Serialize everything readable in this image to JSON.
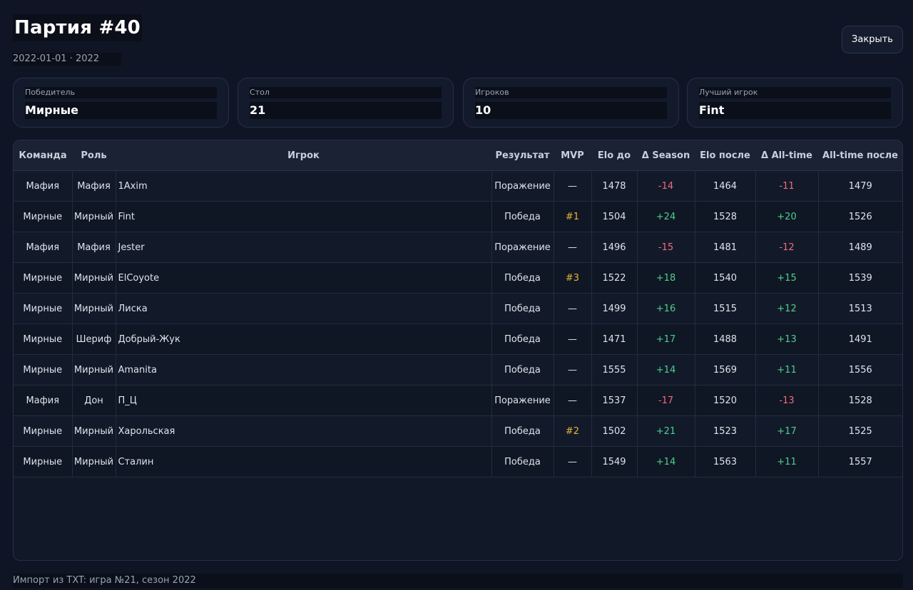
{
  "header": {
    "title": "Партия #40",
    "subtitle": "2022-01-01 · 2022",
    "close_label": "Закрыть"
  },
  "cards": [
    {
      "label": "Победитель",
      "value": "Мирные"
    },
    {
      "label": "Стол",
      "value": "21"
    },
    {
      "label": "Игроков",
      "value": "10"
    },
    {
      "label": "Лучший игрок",
      "value": "Fint"
    }
  ],
  "table": {
    "columns": [
      "Команда",
      "Роль",
      "Игрок",
      "Результат",
      "MVP",
      "Elo до",
      "Δ Season",
      "Elo после",
      "Δ All-time",
      "All-time после"
    ],
    "rows": [
      {
        "team": "Мафия",
        "role": "Мафия",
        "player": "1Axim",
        "result": "Поражение",
        "mvp": "—",
        "elo_before": "1478",
        "d_season": "-14",
        "elo_after": "1464",
        "d_alltime": "-11",
        "alltime_after": "1479"
      },
      {
        "team": "Мирные",
        "role": "Мирный",
        "player": "Fint",
        "result": "Победа",
        "mvp": "#1",
        "elo_before": "1504",
        "d_season": "+24",
        "elo_after": "1528",
        "d_alltime": "+20",
        "alltime_after": "1526"
      },
      {
        "team": "Мафия",
        "role": "Мафия",
        "player": "Jester",
        "result": "Поражение",
        "mvp": "—",
        "elo_before": "1496",
        "d_season": "-15",
        "elo_after": "1481",
        "d_alltime": "-12",
        "alltime_after": "1489"
      },
      {
        "team": "Мирные",
        "role": "Мирный",
        "player": "ElCoyote",
        "result": "Победа",
        "mvp": "#3",
        "elo_before": "1522",
        "d_season": "+18",
        "elo_after": "1540",
        "d_alltime": "+15",
        "alltime_after": "1539"
      },
      {
        "team": "Мирные",
        "role": "Мирный",
        "player": "Лиска",
        "result": "Победа",
        "mvp": "—",
        "elo_before": "1499",
        "d_season": "+16",
        "elo_after": "1515",
        "d_alltime": "+12",
        "alltime_after": "1513"
      },
      {
        "team": "Мирные",
        "role": "Шериф",
        "player": "Добрый-Жук",
        "result": "Победа",
        "mvp": "—",
        "elo_before": "1471",
        "d_season": "+17",
        "elo_after": "1488",
        "d_alltime": "+13",
        "alltime_after": "1491"
      },
      {
        "team": "Мирные",
        "role": "Мирный",
        "player": "Amanita",
        "result": "Победа",
        "mvp": "—",
        "elo_before": "1555",
        "d_season": "+14",
        "elo_after": "1569",
        "d_alltime": "+11",
        "alltime_after": "1556"
      },
      {
        "team": "Мафия",
        "role": "Дон",
        "player": "П_Ц",
        "result": "Поражение",
        "mvp": "—",
        "elo_before": "1537",
        "d_season": "-17",
        "elo_after": "1520",
        "d_alltime": "-13",
        "alltime_after": "1528"
      },
      {
        "team": "Мирные",
        "role": "Мирный",
        "player": "Харольская",
        "result": "Победа",
        "mvp": "#2",
        "elo_before": "1502",
        "d_season": "+21",
        "elo_after": "1523",
        "d_alltime": "+17",
        "alltime_after": "1525"
      },
      {
        "team": "Мирные",
        "role": "Мирный",
        "player": "Сталин",
        "result": "Победа",
        "mvp": "—",
        "elo_before": "1549",
        "d_season": "+14",
        "elo_after": "1563",
        "d_alltime": "+11",
        "alltime_after": "1557"
      }
    ]
  },
  "footer": {
    "text": "Импорт из TXT: игра №21, сезон 2022"
  },
  "colors": {
    "background": "#0f1524",
    "negative": "#ef6b7a",
    "positive": "#4fcf8e",
    "mvp": "#e8b33a"
  }
}
